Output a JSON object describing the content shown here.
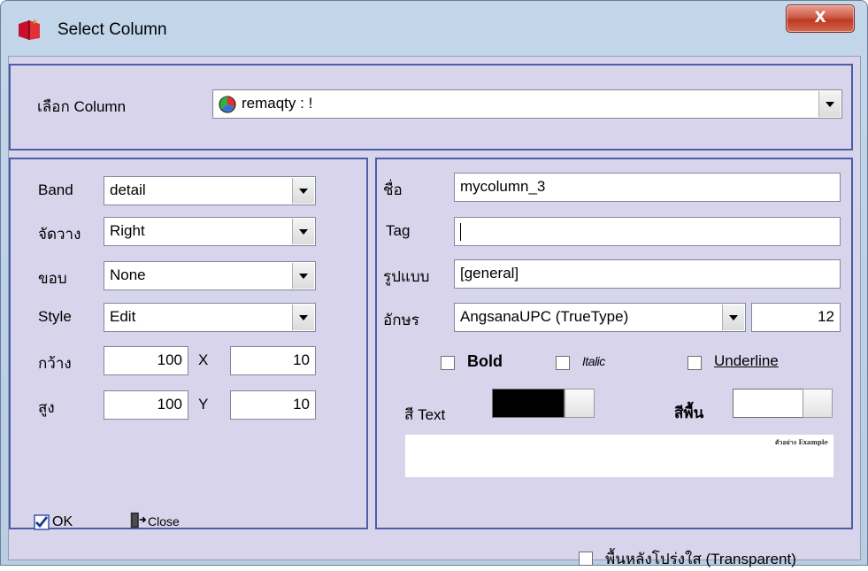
{
  "window": {
    "title": "Select Column",
    "close_label": "X"
  },
  "column_select": {
    "label": "เลือก Column",
    "value": "remaqty : !"
  },
  "left": {
    "band": {
      "label": "Band",
      "value": "detail"
    },
    "align": {
      "label": "จัดวาง",
      "value": "Right"
    },
    "border": {
      "label": "ขอบ",
      "value": "None"
    },
    "style": {
      "label": "Style",
      "value": "Edit"
    },
    "width": {
      "label": "กว้าง",
      "value": "100",
      "x_label": "X",
      "x_value": "10"
    },
    "height": {
      "label": "สูง",
      "value": "100",
      "y_label": "Y",
      "y_value": "10"
    }
  },
  "right": {
    "name": {
      "label": "ชื่อ",
      "value": "mycolumn_3"
    },
    "tag": {
      "label": "Tag",
      "value": ""
    },
    "format": {
      "label": "รูปแบบ",
      "value": "[general]"
    },
    "font": {
      "label": "อักษร",
      "value": "AngsanaUPC (TrueType)",
      "size": "12"
    },
    "bold_label": "Bold",
    "italic_label": "Italic",
    "underline_label": "Underline",
    "text_color": {
      "label": "สี Text",
      "color": "#000000"
    },
    "bg_color": {
      "label": "สีพื้น",
      "color": "#ffffff"
    },
    "preview_text": "ตัวอย่าง Example"
  },
  "buttons": {
    "ok": "OK",
    "close": "Close"
  },
  "transparent_label": "พื้นหลังโปร่งใส (Transparent)"
}
